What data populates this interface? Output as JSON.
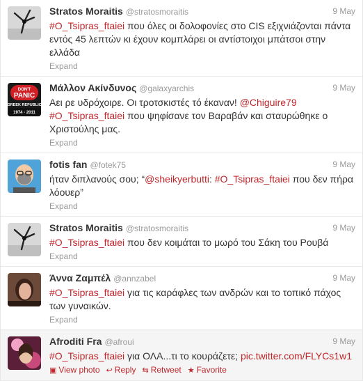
{
  "tweets": [
    {
      "name": "Stratos Moraitis",
      "handle": "@stratosmoraitis",
      "time": "9 May",
      "text_parts": [
        {
          "t": "#O_Tsipras_ftaiei",
          "link": true
        },
        {
          "t": " που όλες οι δολοφονίες στο CIS εξιχνιάζονται πάντα εντός 45 λεπτών κι έχουν κομπλάρει οι αντίστοιχοι μπάτσοι στην ελλάδα",
          "link": false
        }
      ],
      "expand": "Expand",
      "avatar": "windmill"
    },
    {
      "name": "Μάλλον Ακίνδυνος",
      "handle": "@galaxyarchis",
      "time": "9 May",
      "text_parts": [
        {
          "t": "Αει ρε υδρόχοιρε. Οι τροτσκιστές τό έκαναν! ",
          "link": false
        },
        {
          "t": "@Chiguire79",
          "link": true
        },
        {
          "t": " ",
          "link": false
        },
        {
          "t": "#O_Tsipras_ftaiei",
          "link": true
        },
        {
          "t": " που ψηφίσανε τον Βαραβάν και σταυρώθηκε ο Χριστούλης μας.",
          "link": false
        }
      ],
      "expand": "Expand",
      "avatar": "panic",
      "avatar_text": {
        "top": "DON'T",
        "mid": "PANIC",
        "sub": "GREEK REPUBLIC",
        "years": "1974 - 2011"
      }
    },
    {
      "name": "fotis fan",
      "handle": "@fotek75",
      "time": "9 May",
      "text_parts": [
        {
          "t": "ήταν διπλανούς σου; “",
          "link": false
        },
        {
          "t": "@sheikyerbutti",
          "link": true
        },
        {
          "t": ": ",
          "link": false
        },
        {
          "t": "#O_Tsipras_ftaiei",
          "link": true
        },
        {
          "t": " που δεν πήρα λόουερ”",
          "link": false
        }
      ],
      "expand": "Expand",
      "avatar": "cartoon"
    },
    {
      "name": "Stratos Moraitis",
      "handle": "@stratosmoraitis",
      "time": "9 May",
      "text_parts": [
        {
          "t": "#O_Tsipras_ftaiei",
          "link": true
        },
        {
          "t": " που δεν κοιμάται το μωρό του Σάκη του Ρουβά",
          "link": false
        }
      ],
      "expand": "Expand",
      "avatar": "windmill"
    },
    {
      "name": "Άννα Ζαμπέλ",
      "handle": "@annzabel",
      "time": "9 May",
      "text_parts": [
        {
          "t": "#O_Tsipras_ftaiei",
          "link": true
        },
        {
          "t": " για τις καράφλες των ανδρών και το τοπικό πάχος των γυναικών.",
          "link": false
        }
      ],
      "expand": "Expand",
      "avatar": "woman"
    },
    {
      "name": "Afroditi Fra",
      "handle": "@afroui",
      "time": "9 May",
      "text_parts": [
        {
          "t": "#O_Tsipras_ftaiei",
          "link": true
        },
        {
          "t": " για ΟΛΑ...τι το κουράζετε; ",
          "link": false
        },
        {
          "t": "pic.twitter.com/FLYCs1w1",
          "link": true
        }
      ],
      "avatar": "photo",
      "actions": [
        {
          "icon": "▣",
          "label": "View photo",
          "name": "view-photo"
        },
        {
          "icon": "↩",
          "label": "Reply",
          "name": "reply"
        },
        {
          "icon": "⇆",
          "label": "Retweet",
          "name": "retweet"
        },
        {
          "icon": "★",
          "label": "Favorite",
          "name": "favorite"
        }
      ]
    }
  ],
  "colors": {
    "link": "#c0262b",
    "muted": "#999999",
    "text": "#333333"
  }
}
